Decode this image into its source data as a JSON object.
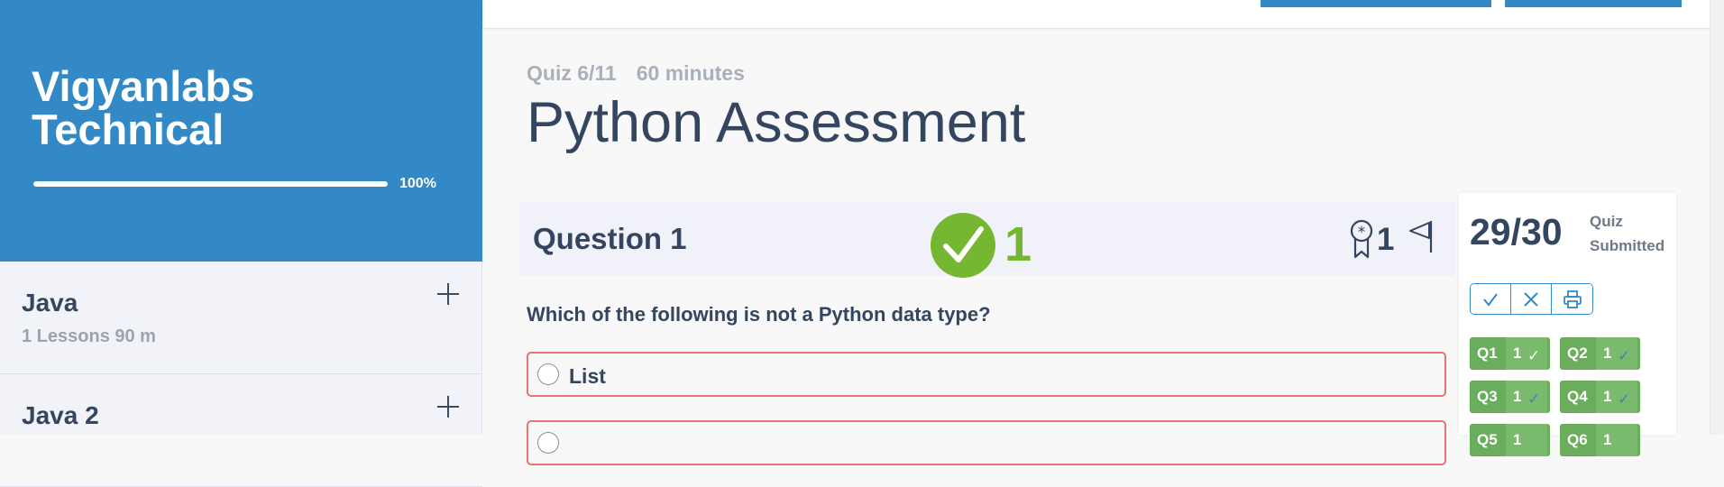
{
  "course": {
    "title": "Vigyanlabs Technical",
    "progress_percent": 100,
    "progress_label": "100%"
  },
  "sidebar": {
    "sections": [
      {
        "title": "Java",
        "meta": "1 Lessons  90 m"
      },
      {
        "title": "Java 2",
        "meta": ""
      }
    ]
  },
  "quiz": {
    "counter": "Quiz 6/11",
    "duration": "60 minutes",
    "title": "Python Assessment"
  },
  "question": {
    "label": "Question 1",
    "score": "1",
    "points": "1",
    "text": "Which of the following is not a Python data type?",
    "options": [
      {
        "label": "List"
      },
      {
        "label": ""
      }
    ]
  },
  "result": {
    "score": "29/30",
    "status": "Quiz Submitted",
    "chips": [
      {
        "q": "Q1",
        "pts": "1",
        "check": "✓",
        "check_color": "#ffffff"
      },
      {
        "q": "Q2",
        "pts": "1",
        "check": "✓",
        "check_color": "#3289c6"
      },
      {
        "q": "Q3",
        "pts": "1",
        "check": "✓",
        "check_color": "#3289c6"
      },
      {
        "q": "Q4",
        "pts": "1",
        "check": "✓",
        "check_color": "#3289c6"
      },
      {
        "q": "Q5",
        "pts": "1",
        "check": "",
        "check_color": "#3289c6"
      },
      {
        "q": "Q6",
        "pts": "1",
        "check": "",
        "check_color": "#3289c6"
      }
    ]
  },
  "colors": {
    "brand": "#3289c6",
    "correct": "#76b731",
    "chip": "#6aad5c",
    "wrong_border": "#e87373",
    "text": "#34455f"
  }
}
